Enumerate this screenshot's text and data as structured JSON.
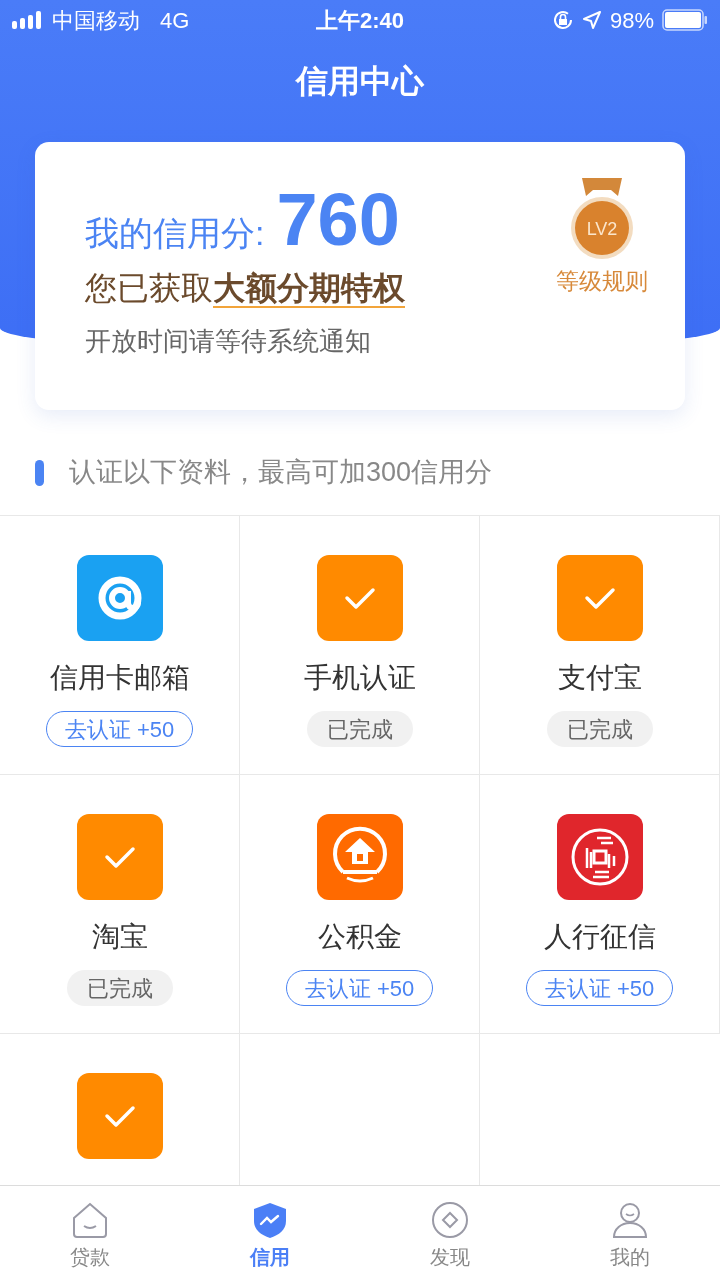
{
  "status_bar": {
    "carrier": "中国移动",
    "network": "4G",
    "time": "上午2:40",
    "battery": "98%"
  },
  "header": {
    "title": "信用中心"
  },
  "score_card": {
    "label": "我的信用分:",
    "score": "760",
    "privilege": "您已获取**大额分期特权**",
    "note": "开放时间请等待系统通知",
    "badge": "LV2",
    "rules_link": "等级规则"
  },
  "section": {
    "title": "认证以下资料，最高可加300信用分"
  },
  "tiles": [
    {
      "kind": "email",
      "title": "信用卡邮箱",
      "completed": false,
      "status": "去认证 +50"
    },
    {
      "kind": "check",
      "title": "手机认证",
      "completed": true,
      "status": "已完成"
    },
    {
      "kind": "check",
      "title": "支付宝",
      "completed": true,
      "status": "已完成"
    },
    {
      "kind": "check",
      "title": "淘宝",
      "completed": true,
      "status": "已完成"
    },
    {
      "kind": "fund",
      "title": "公积金",
      "completed": false,
      "status": "去认证 +50"
    },
    {
      "kind": "credit",
      "title": "人行征信",
      "completed": false,
      "status": "去认证 +50"
    },
    {
      "kind": "check"
    }
  ],
  "tab_bar": [
    {
      "kind": "home",
      "label": "贷款",
      "selected": false
    },
    {
      "kind": "shield",
      "label": "信用",
      "selected": true
    },
    {
      "kind": "discover",
      "label": "发现",
      "selected": false
    },
    {
      "kind": "user",
      "label": "我的",
      "selected": false
    }
  ]
}
